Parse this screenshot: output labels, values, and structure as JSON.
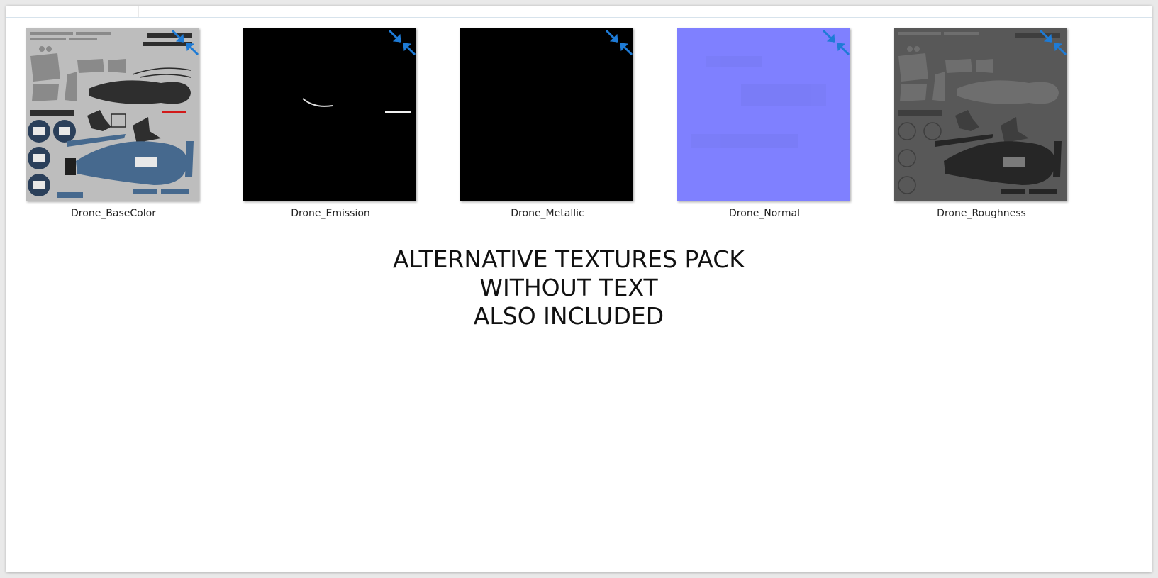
{
  "colors": {
    "badge_arrow": "#1e7bd6",
    "normal_map": "#7f80ff",
    "emission_bg": "#000000",
    "basecolor_bg": "#bcbcbc",
    "roughness_bg": "#585858"
  },
  "files": [
    {
      "name": "Drone_BaseColor",
      "icon": "compress-arrows-icon"
    },
    {
      "name": "Drone_Emission",
      "icon": "compress-arrows-icon"
    },
    {
      "name": "Drone_Metallic",
      "icon": "compress-arrows-icon"
    },
    {
      "name": "Drone_Normal",
      "icon": "compress-arrows-icon"
    },
    {
      "name": "Drone_Roughness",
      "icon": "compress-arrows-icon"
    }
  ],
  "notice": {
    "line1": "ALTERNATIVE TEXTURES PACK",
    "line2": "WITHOUT TEXT",
    "line3": "ALSO INCLUDED"
  }
}
